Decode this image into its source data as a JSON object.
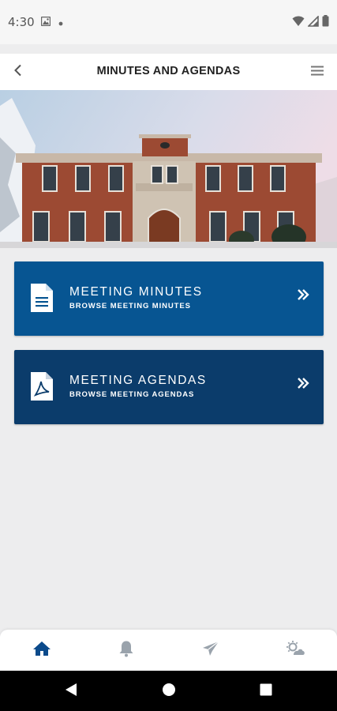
{
  "status_bar": {
    "time": "4:30"
  },
  "header": {
    "title": "MINUTES AND AGENDAS"
  },
  "cards": [
    {
      "title": "MEETING MINUTES",
      "subtitle": "BROWSE MEETING MINUTES",
      "icon": "document-icon"
    },
    {
      "title": "MEETING AGENDAS",
      "subtitle": "BROWSE MEETING AGENDAS",
      "icon": "pdf-icon"
    }
  ],
  "tabs": [
    {
      "icon": "home-icon",
      "active": true
    },
    {
      "icon": "bell-icon",
      "active": false
    },
    {
      "icon": "send-icon",
      "active": false
    },
    {
      "icon": "weather-icon",
      "active": false
    }
  ],
  "colors": {
    "minutes_card": "#075592",
    "agendas_card": "#0b3c6b",
    "active_tab": "#0b4a8b",
    "inactive_tab": "#9aa3ac"
  }
}
